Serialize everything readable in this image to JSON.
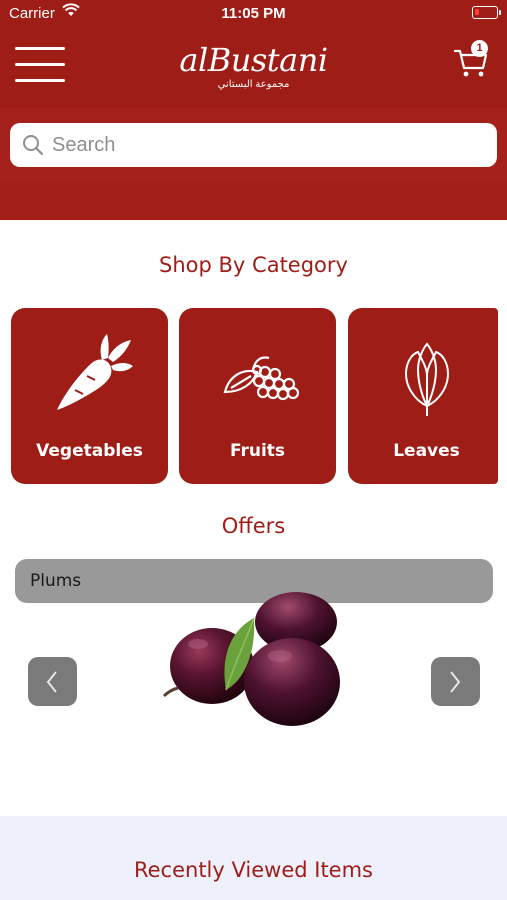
{
  "status": {
    "carrier": "Carrier",
    "time": "11:05 PM"
  },
  "header": {
    "logo_text": "alBustani",
    "logo_subtitle": "مجموعة البستاني",
    "cart_count": "1",
    "brand_color": "#9e1d17"
  },
  "search": {
    "placeholder": "Search"
  },
  "categories": {
    "title": "Shop By Category",
    "items": [
      {
        "label": "Vegetables",
        "icon": "carrot-icon"
      },
      {
        "label": "Fruits",
        "icon": "grapes-icon"
      },
      {
        "label": "Leaves",
        "icon": "tulip-icon"
      }
    ]
  },
  "offers": {
    "title": "Offers",
    "current_item": "Plums"
  },
  "recent": {
    "title": "Recently Viewed Items"
  }
}
